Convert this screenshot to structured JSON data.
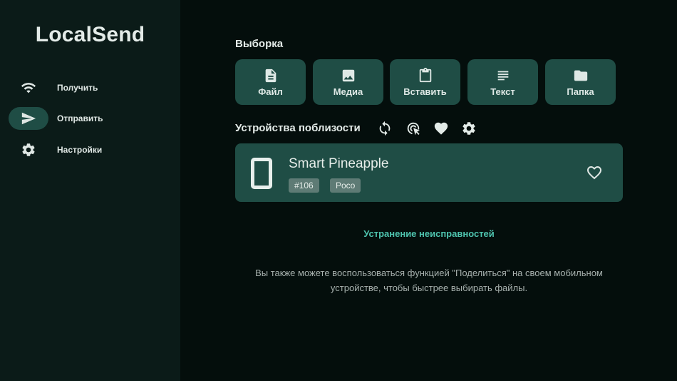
{
  "app": {
    "title": "LocalSend"
  },
  "nav": {
    "receive": "Получить",
    "send": "Отправить",
    "settings": "Настройки"
  },
  "selection": {
    "title": "Выборка",
    "buttons": {
      "file": "Файл",
      "media": "Медиа",
      "paste": "Вставить",
      "text": "Текст",
      "folder": "Папка"
    }
  },
  "nearby": {
    "title": "Устройства поблизости",
    "devices": [
      {
        "name": "Smart Pineapple",
        "tags": [
          "#106",
          "Poco"
        ]
      }
    ]
  },
  "troubleshoot": "Устранение неисправностей",
  "hint": "Вы также можете воспользоваться функцией \"Поделиться\" на своем мобильном устройстве, чтобы быстрее выбирать файлы.",
  "colors": {
    "background": "#040e0c",
    "sidebar": "#0b1b18",
    "accent_surface": "#1f4d45",
    "link": "#4ec3ae",
    "badge": "#5e7b75"
  }
}
